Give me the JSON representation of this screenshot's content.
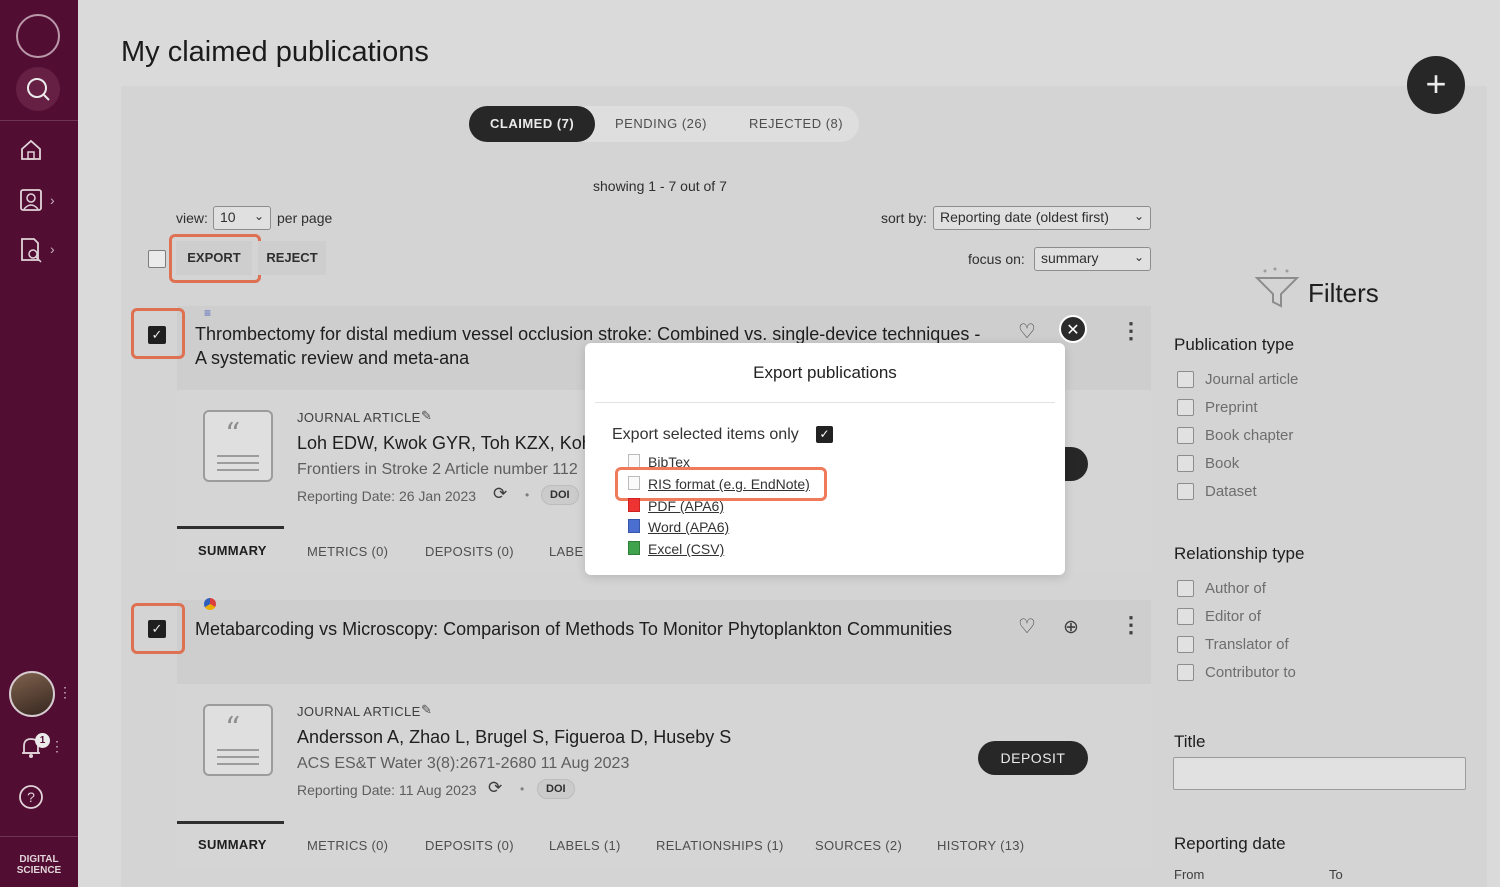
{
  "sidebar": {
    "brand": "DIGITAL SCIENCE",
    "notification_count": "1",
    "icons": [
      "university-logo",
      "search-icon",
      "home-icon",
      "profile-icon",
      "document-search-icon",
      "avatar",
      "bell-icon",
      "help-icon"
    ]
  },
  "page": {
    "title": "My claimed publications",
    "add_label": "+"
  },
  "tabs": [
    {
      "label": "CLAIMED (7)",
      "active": true
    },
    {
      "label": "PENDING (26)",
      "active": false
    },
    {
      "label": "REJECTED (8)",
      "active": false
    }
  ],
  "listing": {
    "showing": "showing 1 - 7 out of 7",
    "view_label": "view:",
    "view_value": "10",
    "per_page": "per page",
    "sort_label": "sort by:",
    "sort_value": "Reporting date (oldest first)",
    "focus_label": "focus on:",
    "focus_value": "summary",
    "export_label": "EXPORT",
    "reject_label": "REJECT"
  },
  "publications": [
    {
      "title": "Thrombectomy for distal medium vessel occlusion stroke: Combined vs. single-device techniques - A systematic review and meta-ana",
      "type": "JOURNAL ARTICLE",
      "authors": "Loh EDW, Kwok GYR, Toh KZX, Koh I",
      "journal": "Frontiers in Stroke 2 Article number 112",
      "reporting_date": "Reporting Date: 26 Jan 2023",
      "doi": "DOI",
      "deposit": "DEPOSIT",
      "checked": true,
      "subtabs": [
        "SUMMARY",
        "METRICS (0)",
        "DEPOSITS (0)",
        "LABE"
      ]
    },
    {
      "title": "Metabarcoding vs Microscopy: Comparison of Methods To Monitor Phytoplankton Communities",
      "type": "JOURNAL ARTICLE",
      "authors": "Andersson A, Zhao L, Brugel S, Figueroa D, Huseby S",
      "journal": "ACS ES&T Water 3(8):2671-2680 11 Aug 2023",
      "reporting_date": "Reporting Date: 11 Aug 2023",
      "doi": "DOI",
      "deposit": "DEPOSIT",
      "checked": true,
      "subtabs": [
        "SUMMARY",
        "METRICS (0)",
        "DEPOSITS (0)",
        "LABELS (1)",
        "RELATIONSHIPS (1)",
        "SOURCES (2)",
        "HISTORY (13)"
      ]
    }
  ],
  "filters": {
    "heading": "Filters",
    "publication_type": {
      "title": "Publication type",
      "items": [
        "Journal article",
        "Preprint",
        "Book chapter",
        "Book",
        "Dataset"
      ]
    },
    "relationship_type": {
      "title": "Relationship type",
      "items": [
        "Author of",
        "Editor of",
        "Translator of",
        "Contributor to"
      ]
    },
    "title_label": "Title",
    "reporting_date": {
      "title": "Reporting date",
      "from": "From",
      "to": "To"
    }
  },
  "export_modal": {
    "title": "Export publications",
    "selected_only_label": "Export selected items only",
    "selected_only_checked": true,
    "options": [
      {
        "label": "BibTex",
        "icon": "text-file-icon"
      },
      {
        "label": "RIS format (e.g. EndNote)",
        "icon": "text-file-icon"
      },
      {
        "label": "PDF (APA6)",
        "icon": "pdf-file-icon"
      },
      {
        "label": "Word (APA6)",
        "icon": "word-file-icon"
      },
      {
        "label": "Excel (CSV)",
        "icon": "excel-file-icon"
      }
    ],
    "close_label": "✕"
  },
  "colors": {
    "sidebar": "#5a0f37",
    "dark": "#2b2b2b",
    "highlight": "#f07b5a"
  }
}
